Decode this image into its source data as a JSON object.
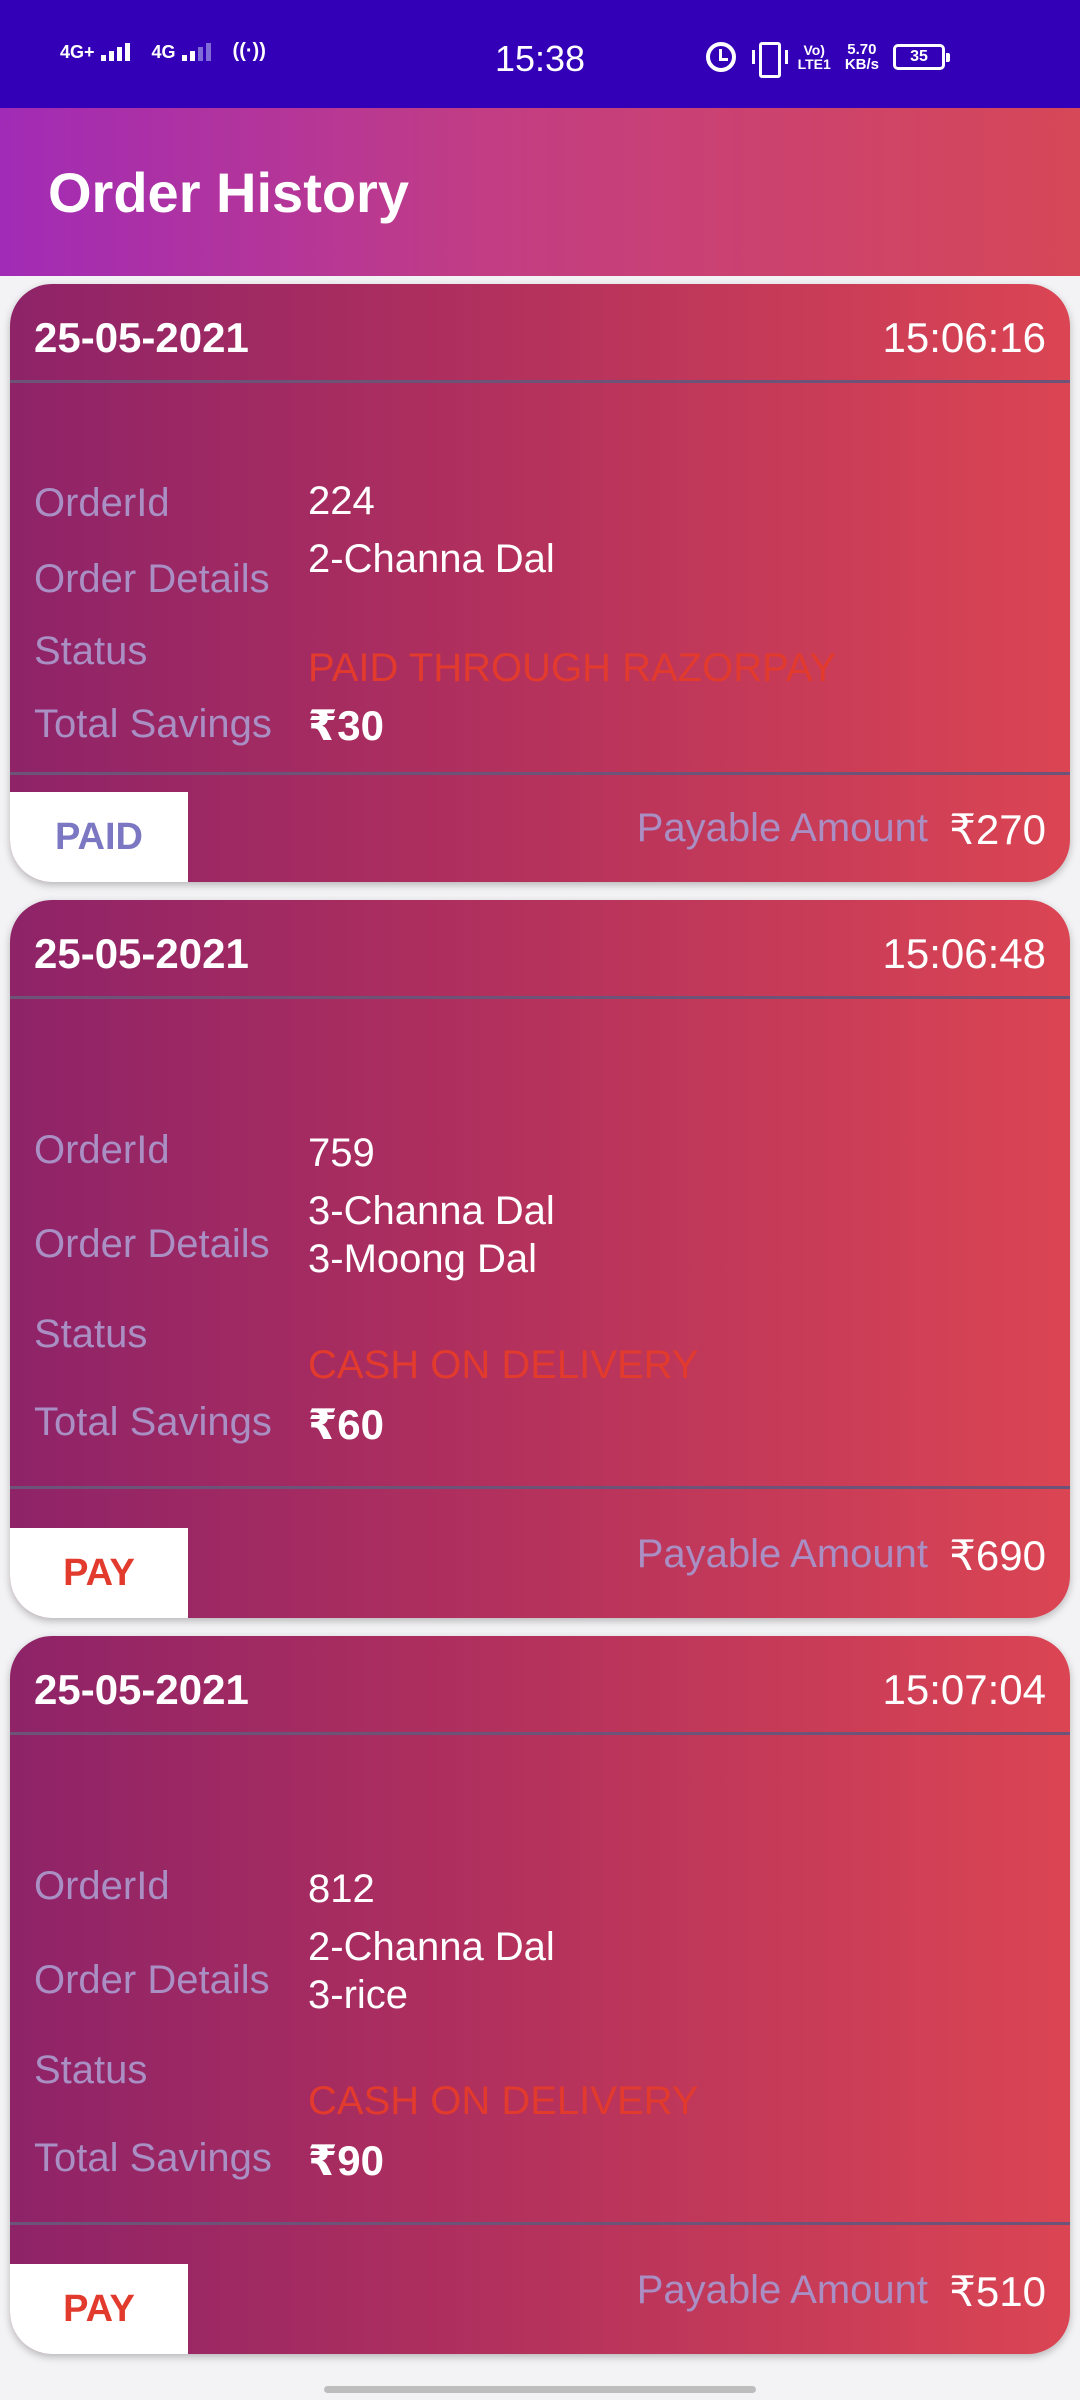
{
  "status_bar": {
    "net1": "4G+",
    "net2": "4G",
    "hotspot": "((·))",
    "time": "15:38",
    "volte_top": "Vo)",
    "volte_bottom": "LTE1",
    "speed_value": "5.70",
    "speed_unit": "KB/s",
    "battery": "35"
  },
  "app_bar": {
    "title": "Order History"
  },
  "labels": {
    "order_id": "OrderId",
    "order_details": "Order Details",
    "status": "Status",
    "total_savings": "Total Savings",
    "payable_amount": "Payable Amount"
  },
  "orders": [
    {
      "date": "25-05-2021",
      "time": "15:06:16",
      "order_id": "224",
      "details": [
        "2-Channa Dal"
      ],
      "status": "PAID THROUGH RAZORPAY",
      "savings": "₹30",
      "payable": "₹270",
      "button": "PAID"
    },
    {
      "date": "25-05-2021",
      "time": "15:06:48",
      "order_id": "759",
      "details": [
        "3-Channa Dal",
        "3-Moong Dal"
      ],
      "status": "CASH ON DELIVERY",
      "savings": "₹60",
      "payable": "₹690",
      "button": "PAY"
    },
    {
      "date": "25-05-2021",
      "time": "15:07:04",
      "order_id": "812",
      "details": [
        "2-Channa Dal",
        "3-rice"
      ],
      "status": "CASH ON DELIVERY",
      "savings": "₹90",
      "payable": "₹510",
      "button": "PAY"
    }
  ]
}
